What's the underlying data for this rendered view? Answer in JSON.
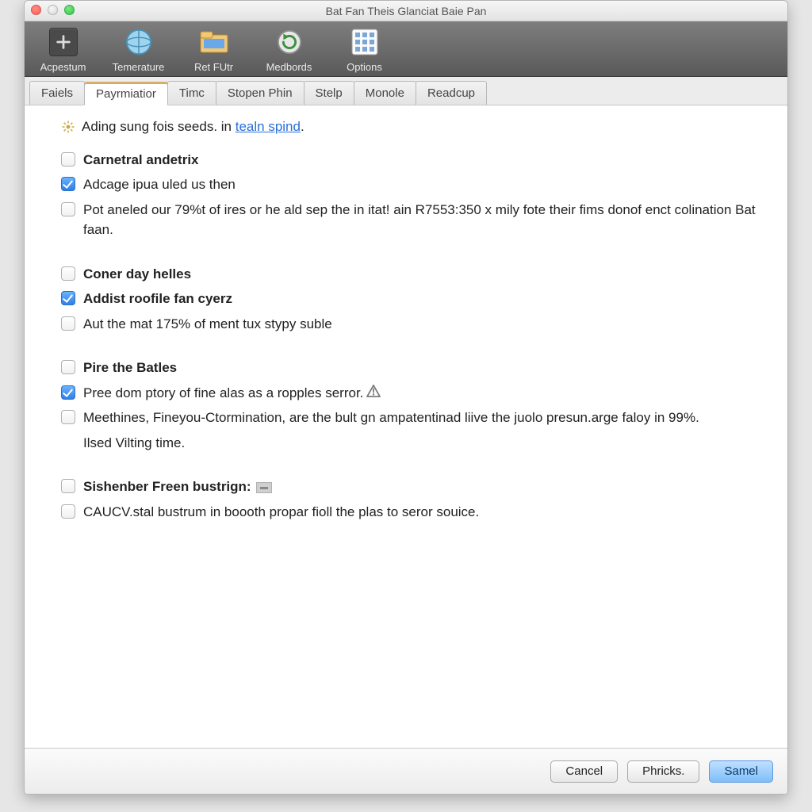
{
  "window": {
    "title": "Bat Fan Theis Glanciat Baie Pan"
  },
  "toolbar": [
    {
      "name": "acpestum",
      "label": "Acpestum",
      "icon": "plus-icon"
    },
    {
      "name": "temerature",
      "label": "Temerature",
      "icon": "globe-icon"
    },
    {
      "name": "ret-futr",
      "label": "Ret FUtr",
      "icon": "folder-icon"
    },
    {
      "name": "medbords",
      "label": "Medbords",
      "icon": "refresh-icon"
    },
    {
      "name": "options",
      "label": "Options",
      "icon": "grid-icon"
    }
  ],
  "tabs": [
    {
      "name": "faiels",
      "label": "Faiels",
      "active": false
    },
    {
      "name": "payrmiatior",
      "label": "Payrmiatior",
      "active": true
    },
    {
      "name": "timc",
      "label": "Timc",
      "active": false
    },
    {
      "name": "stopen-phin",
      "label": "Stopen Phin",
      "active": false
    },
    {
      "name": "stelp",
      "label": "Stelp",
      "active": false
    },
    {
      "name": "monole",
      "label": "Monole",
      "active": false
    },
    {
      "name": "readcup",
      "label": "Readcup",
      "active": false
    }
  ],
  "info": {
    "prefix": "Ading sung fois seeds. in ",
    "link": "tealn spind",
    "suffix": "."
  },
  "groups": [
    {
      "header": {
        "label": "Carnetral andetrix",
        "checked": false
      },
      "items": [
        {
          "label": "Adcage ipua uled us then",
          "checked": true
        },
        {
          "label": "Pot aneled our 79%t of ires or he ald sep the in itat! ain R7553:350 x mily fote their fims donof enct colination Bat faan.",
          "checked": false
        }
      ]
    },
    {
      "header": {
        "label": "Coner day helles",
        "checked": false
      },
      "items": [
        {
          "label": "Addist roofile fan cyerz",
          "checked": true,
          "bold": true
        },
        {
          "label": "Aut the mat 175% of ment tux stypy suble",
          "checked": false
        }
      ]
    },
    {
      "header": {
        "label": "Pire the Batles",
        "checked": false
      },
      "items": [
        {
          "label": "Pree dom ptory of fine alas as a ropples serror.",
          "checked": true,
          "warn": true
        },
        {
          "label": "Meethines,  Fineyou-Ctormination, are the bult gn ampatentinad liive the juolo presun.arge faloy in 99%.",
          "checked": false
        },
        {
          "label": "Ilsed Vilting time.",
          "plain": true
        }
      ]
    },
    {
      "header": {
        "label": "Sishenber Freen bustrign:",
        "checked": false,
        "dash": true
      },
      "items": [
        {
          "label": "CAUCV.stal bustrum in boooth propar fioll the plas to seror souice.",
          "checked": false
        }
      ]
    }
  ],
  "footer": {
    "cancel": "Cancel",
    "phricks": "Phricks.",
    "samel": "Samel"
  }
}
